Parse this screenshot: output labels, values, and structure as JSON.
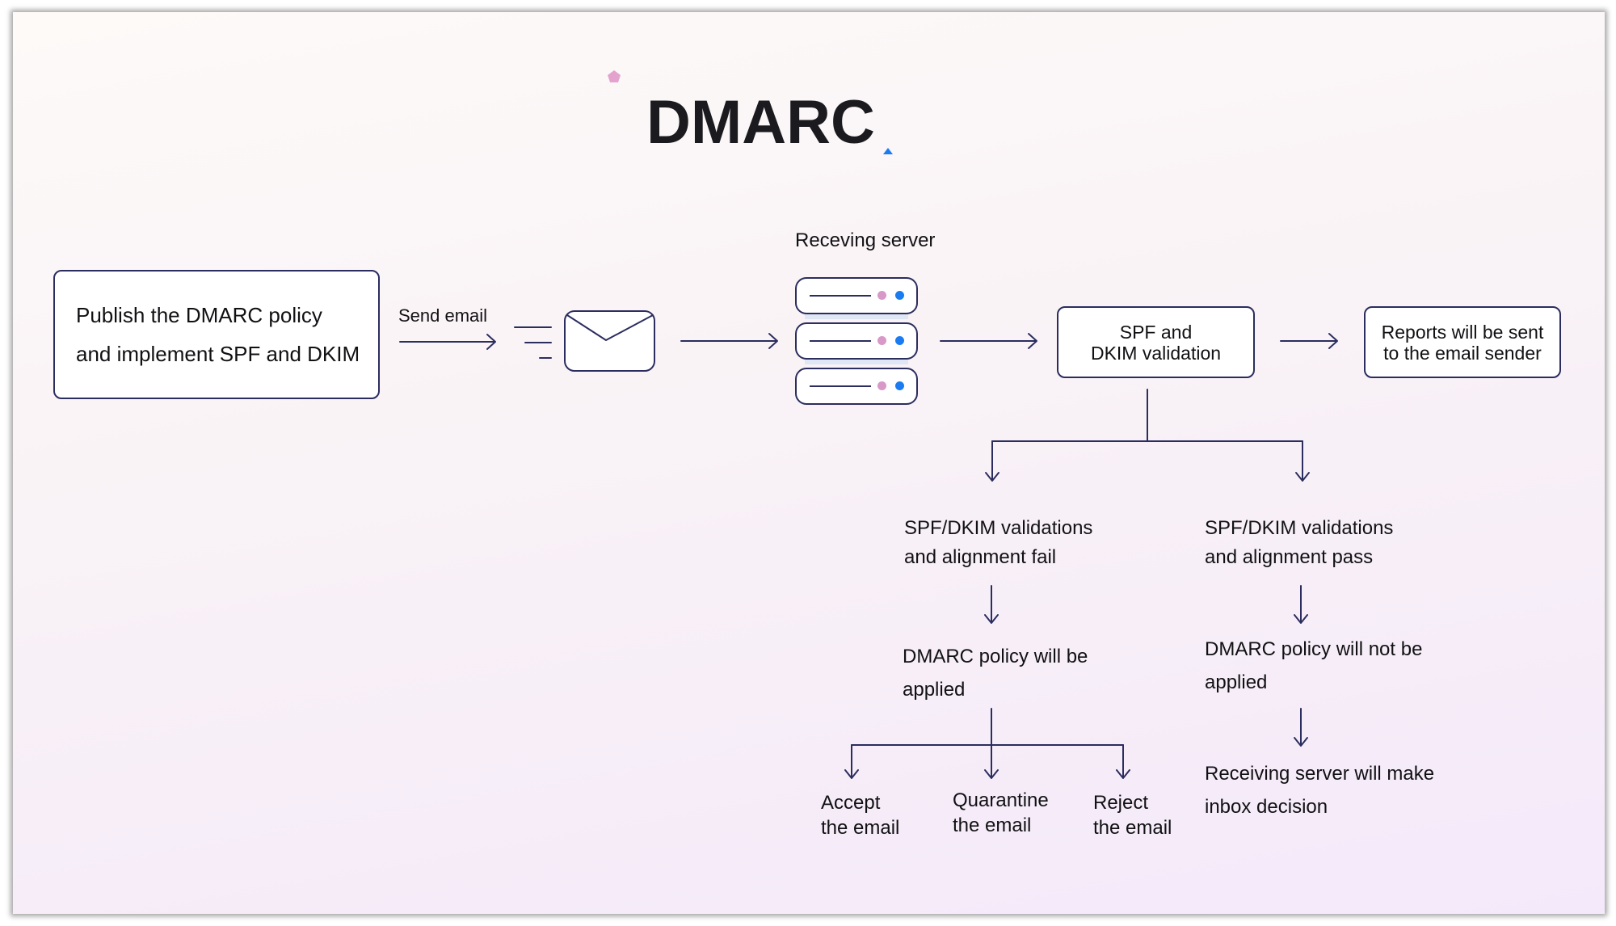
{
  "title": "DMARC",
  "colors": {
    "line": "#2b2d5e",
    "accent_pink": "#e4a3cf",
    "accent_blue": "#1a7cf0",
    "text": "#111114"
  },
  "decorations": {
    "pentagon_icon": "pink pentagon",
    "triangle_icon": "blue triangle"
  },
  "steps": {
    "publish": {
      "line1": "Publish the DMARC policy",
      "line2": "and implement SPF and DKIM"
    },
    "send_email_label": "Send email",
    "receiving_server_label": "Receving server",
    "validation": {
      "line1": "SPF and",
      "line2": "DKIM validation"
    },
    "reports": {
      "line1": "Reports will be sent",
      "line2": "to the email sender"
    }
  },
  "branches": {
    "fail": {
      "condition": {
        "line1": "SPF/DKIM validations",
        "line2": "and alignment fail"
      },
      "result": {
        "line1": "DMARC policy will be",
        "line2": "applied"
      },
      "actions": [
        {
          "line1": "Accept",
          "line2": "the email"
        },
        {
          "line1": "Quarantine",
          "line2": "the email"
        },
        {
          "line1": "Reject",
          "line2": "the email"
        }
      ]
    },
    "pass": {
      "condition": {
        "line1": "SPF/DKIM validations",
        "line2": "and alignment pass"
      },
      "result": {
        "line1": "DMARC policy will not be",
        "line2": "applied"
      },
      "outcome": {
        "line1": "Receiving server will make",
        "line2": "inbox decision"
      }
    }
  }
}
